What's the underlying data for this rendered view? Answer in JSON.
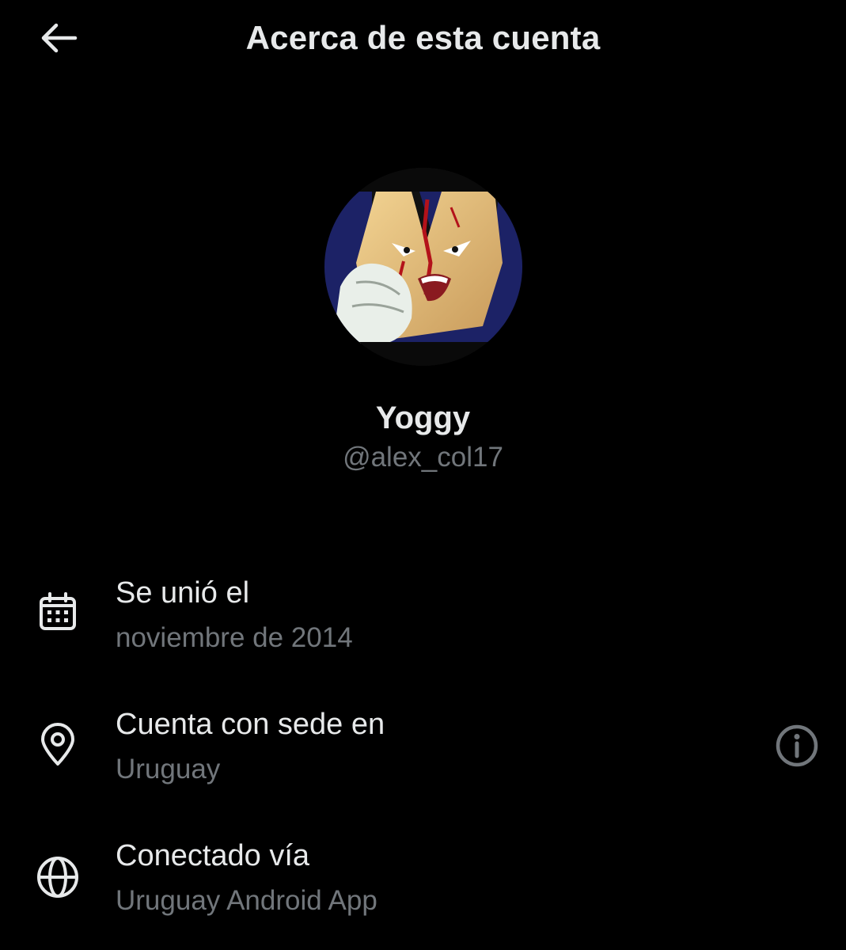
{
  "header": {
    "title": "Acerca de esta cuenta",
    "back_icon": "arrow-left-icon"
  },
  "profile": {
    "display_name": "Yoggy",
    "handle": "@alex_col17"
  },
  "info": {
    "joined": {
      "icon": "calendar-icon",
      "label": "Se unió el",
      "value": "noviembre de 2014"
    },
    "location": {
      "icon": "location-pin-icon",
      "label": "Cuenta con sede en",
      "value": "Uruguay",
      "help_icon": "info-circle-icon"
    },
    "connected": {
      "icon": "globe-icon",
      "label": "Conectado vía",
      "value": "Uruguay Android App"
    }
  },
  "colors": {
    "background": "#000000",
    "primary_text": "#e7e9ea",
    "secondary_text": "#71767b"
  }
}
